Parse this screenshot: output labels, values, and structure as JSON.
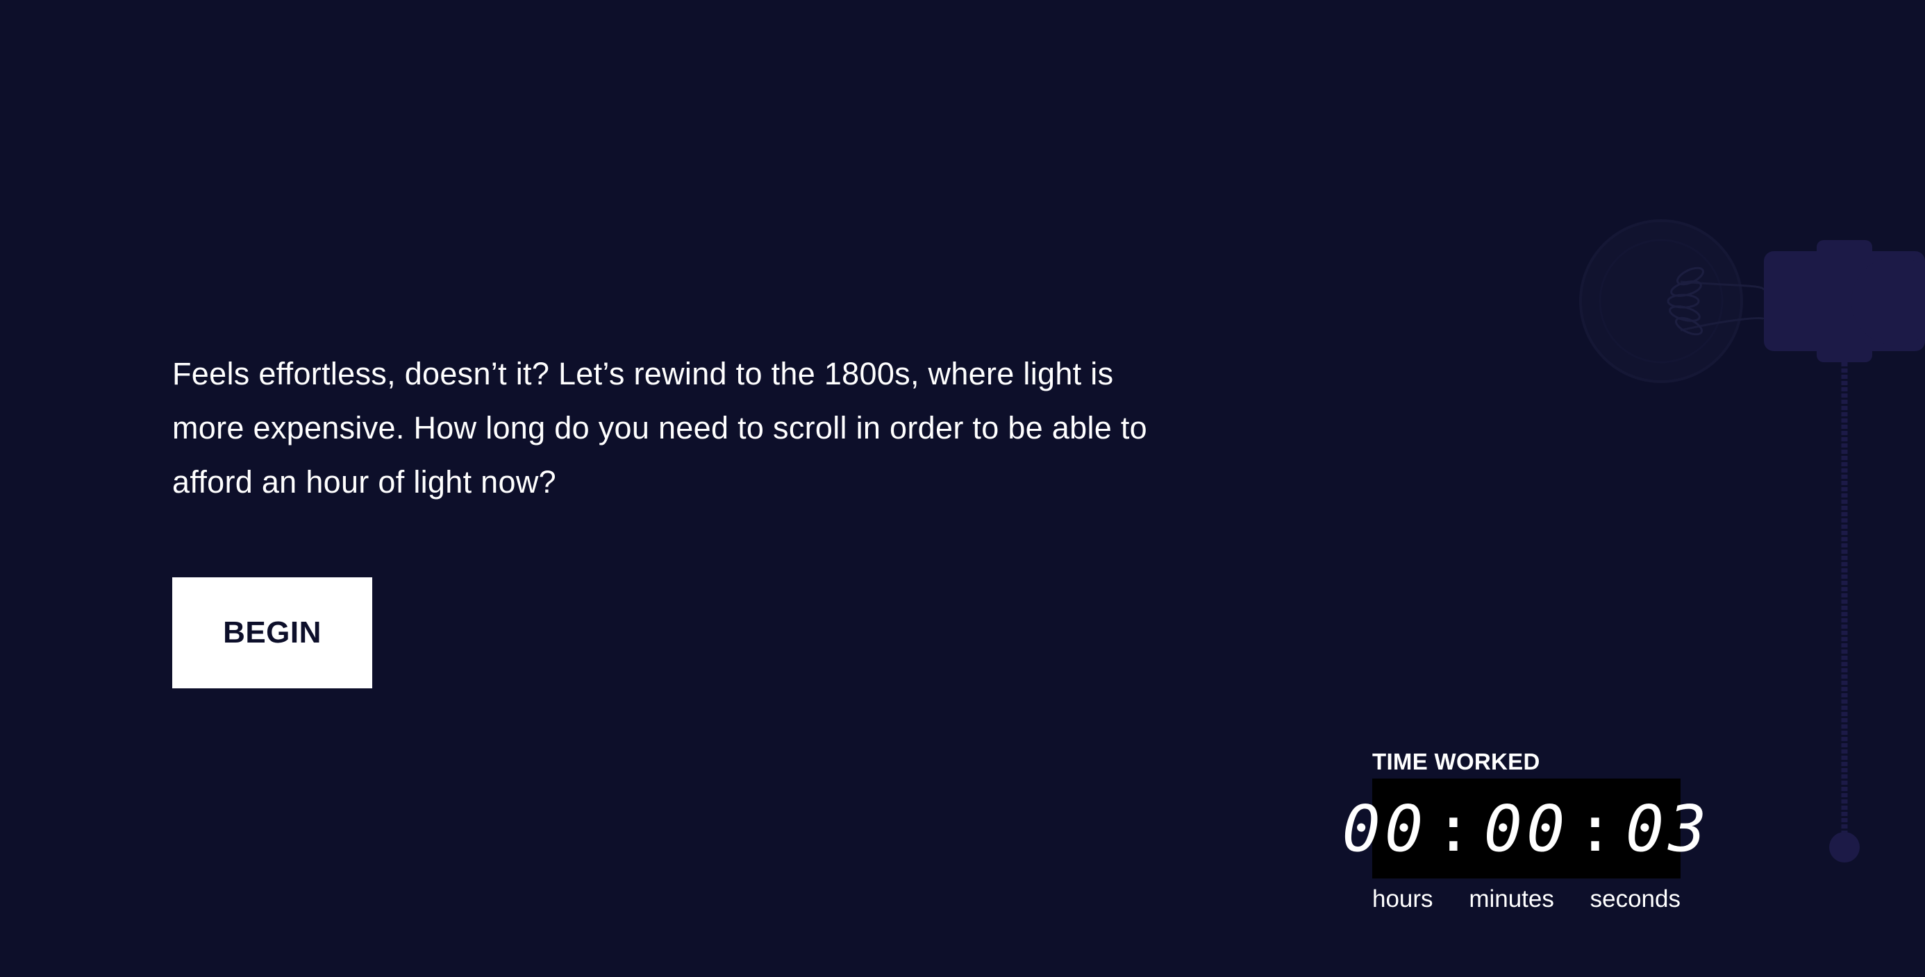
{
  "intro": {
    "text": "Feels effortless, doesn’t it? Let’s rewind to the 1800s, where light is more expensive. How long do you need to scroll in order to be able to afford an hour of light now?"
  },
  "cta": {
    "begin_label": "BEGIN"
  },
  "timer": {
    "title": "TIME WORKED",
    "hours": "00",
    "minutes": "00",
    "seconds": "03",
    "separator": ":",
    "units": {
      "hours": "hours",
      "minutes": "minutes",
      "seconds": "seconds"
    }
  },
  "icons": {
    "bulb": "light-bulb-icon",
    "pull_chain": "pull-chain-icon"
  },
  "colors": {
    "background": "#0d0f2a",
    "text": "#ffffff",
    "button_bg": "#ffffff",
    "timer_bg": "#000000",
    "lamp": "#1c1a47"
  }
}
